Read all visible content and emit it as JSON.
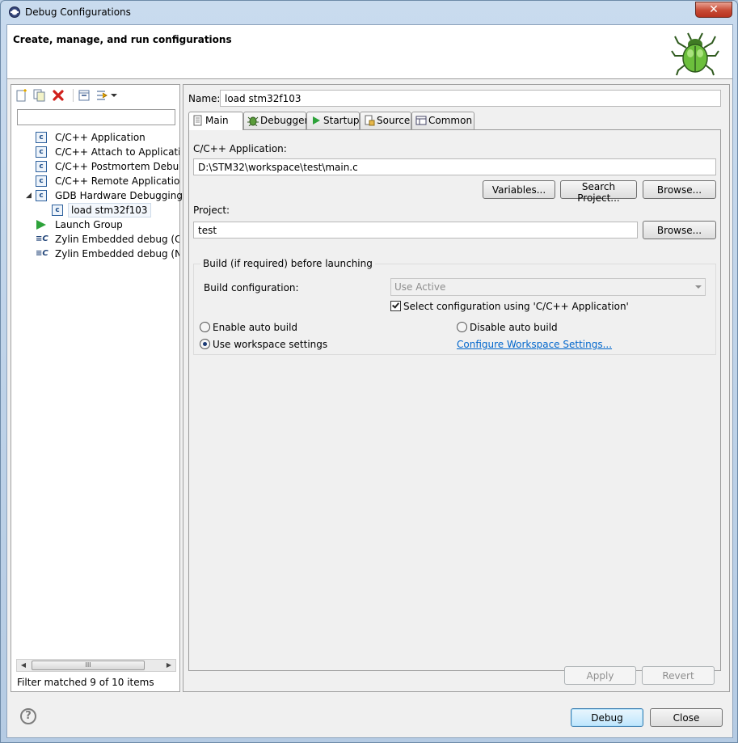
{
  "window": {
    "title": "Debug Configurations",
    "close_glyph": "✕"
  },
  "header": {
    "title": "Create, manage, and run configurations",
    "icon": "bug-icon"
  },
  "left": {
    "filter_placeholder": "",
    "tree": [
      {
        "label": "C/C++ Application",
        "icon": "c-config-icon"
      },
      {
        "label": "C/C++ Attach to Application",
        "icon": "c-config-icon"
      },
      {
        "label": "C/C++ Postmortem Debugge",
        "icon": "c-config-icon"
      },
      {
        "label": "C/C++ Remote Application",
        "icon": "c-config-icon"
      },
      {
        "label": "GDB Hardware Debugging",
        "icon": "c-config-icon",
        "expanded": true
      },
      {
        "label": "load stm32f103",
        "icon": "c-config-icon",
        "selected": true
      },
      {
        "label": "Launch Group",
        "icon": "play-icon"
      },
      {
        "label": "Zylin Embedded debug (Cygw",
        "icon": "zylin-icon"
      },
      {
        "label": "Zylin Embedded debug (Nati",
        "icon": "zylin-icon"
      }
    ],
    "scroll_thumb_glyph": "III",
    "filter_status": "Filter matched 9 of 10 items"
  },
  "config": {
    "name_label": "Name:",
    "name_value": "load stm32f103",
    "tabs": [
      {
        "label": "Main",
        "active": true
      },
      {
        "label": "Debugger"
      },
      {
        "label": "Startup"
      },
      {
        "label": "Source"
      },
      {
        "label": "Common"
      }
    ],
    "main": {
      "app_label": "C/C++ Application:",
      "app_value": "D:\\STM32\\workspace\\test\\main.c",
      "variables_button": "Variables...",
      "search_project_button": "Search Project...",
      "browse_button": "Browse...",
      "project_label": "Project:",
      "project_value": "test",
      "project_browse_button": "Browse...",
      "build_group_title": "Build (if required) before launching",
      "build_config_label": "Build configuration:",
      "build_config_value": "Use Active",
      "select_config_label": "Select configuration using 'C/C++ Application'",
      "enable_auto_build": "Enable auto build",
      "disable_auto_build": "Disable auto build",
      "use_workspace_settings": "Use workspace settings",
      "configure_workspace_link": "Configure Workspace Settings..."
    },
    "apply_button": "Apply",
    "revert_button": "Revert"
  },
  "footer": {
    "help_glyph": "?",
    "debug_button": "Debug",
    "close_button": "Close"
  },
  "colors": {
    "link": "#0066cc",
    "accent": "#3c7fb1",
    "close": "#c74a34"
  }
}
